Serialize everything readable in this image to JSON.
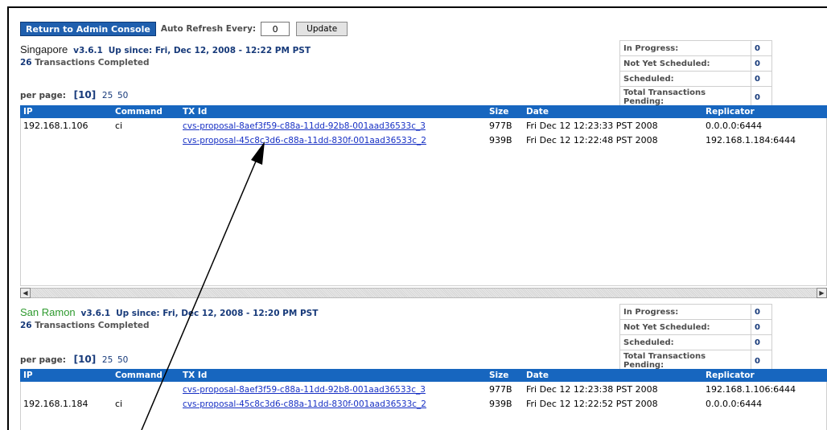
{
  "toolbar": {
    "admin_label": "Return to Admin Console",
    "auto_refresh_label": "Auto Refresh Every:",
    "refresh_value": "0",
    "update_label": "Update"
  },
  "columns": {
    "ip": "IP",
    "command": "Command",
    "txid": "TX Id",
    "size": "Size",
    "date": "Date",
    "replicator": "Replicator"
  },
  "per_page": {
    "label": "per page:",
    "current": "[10]",
    "opt1": "25",
    "opt2": "50"
  },
  "stat_labels": {
    "in_progress": "In Progress:",
    "not_yet": "Not Yet Scheduled:",
    "scheduled": "Scheduled:",
    "pending": "Total Transactions Pending:"
  },
  "panels": [
    {
      "name": "Singapore",
      "version": "v3.6.1",
      "up_since": "Up since: Fri, Dec 12, 2008 - 12:22 PM PST",
      "completed_count": "26",
      "completed_label": "Transactions Completed",
      "stats": {
        "in_progress": "0",
        "not_yet": "0",
        "scheduled": "0",
        "pending": "0"
      },
      "rows": [
        {
          "ip": "192.168.1.106",
          "command": "ci",
          "txid": "cvs-proposal-8aef3f59-c88a-11dd-92b8-001aad36533c_3",
          "size": "977B",
          "date": "Fri Dec 12 12:23:33 PST 2008",
          "replicator": "0.0.0.0:6444"
        },
        {
          "ip": "",
          "command": "",
          "txid": "cvs-proposal-45c8c3d6-c88a-11dd-830f-001aad36533c_2",
          "size": "939B",
          "date": "Fri Dec 12 12:22:48 PST 2008",
          "replicator": "192.168.1.184:6444"
        }
      ]
    },
    {
      "name": "San Ramon",
      "version": "v3.6.1",
      "up_since": "Up since: Fri, Dec 12, 2008 - 12:20 PM PST",
      "completed_count": "26",
      "completed_label": "Transactions Completed",
      "stats": {
        "in_progress": "0",
        "not_yet": "0",
        "scheduled": "0",
        "pending": "0"
      },
      "rows": [
        {
          "ip": "",
          "command": "",
          "txid": "cvs-proposal-8aef3f59-c88a-11dd-92b8-001aad36533c_3",
          "size": "977B",
          "date": "Fri Dec 12 12:23:38 PST 2008",
          "replicator": "192.168.1.106:6444"
        },
        {
          "ip": "192.168.1.184",
          "command": "ci",
          "txid": "cvs-proposal-45c8c3d6-c88a-11dd-830f-001aad36533c_2",
          "size": "939B",
          "date": "Fri Dec 12 12:22:52 PST 2008",
          "replicator": "0.0.0.0:6444"
        }
      ]
    }
  ],
  "colors": {
    "singapore": "#1a1a1a",
    "san_ramon": "#2e9a2e",
    "header_blue": "#1766bf",
    "link_blue": "#1730c4"
  },
  "icons": {
    "scroll_left": "triangle-left",
    "scroll_right": "triangle-right",
    "callout": "arrow"
  }
}
